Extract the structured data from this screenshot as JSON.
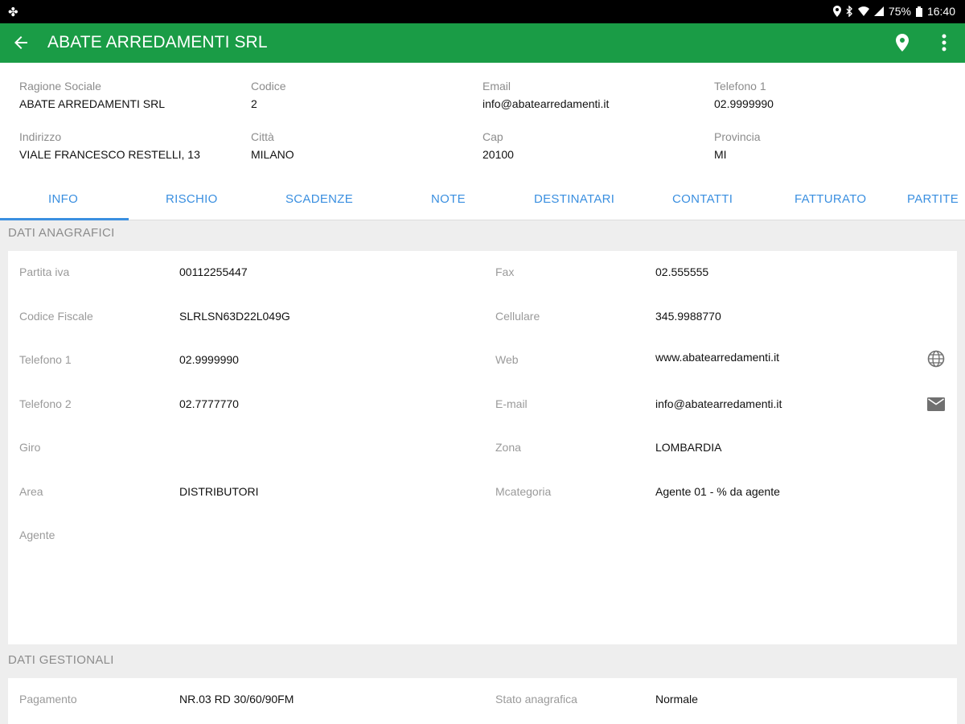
{
  "status_bar": {
    "left_icon": "app-notification-icon",
    "battery": "75%",
    "time": "16:40"
  },
  "app_bar": {
    "title": "ABATE ARREDAMENTI SRL",
    "icons": [
      "back-arrow-icon",
      "location-pin-icon",
      "more-vert-icon"
    ],
    "color": "#1a9c46"
  },
  "header": {
    "ragione_sociale": {
      "label": "Ragione Sociale",
      "value": "ABATE ARREDAMENTI SRL"
    },
    "codice": {
      "label": "Codice",
      "value": "2"
    },
    "email": {
      "label": "Email",
      "value": "info@abatearredamenti.it"
    },
    "telefono1": {
      "label": "Telefono 1",
      "value": "02.9999990"
    },
    "indirizzo": {
      "label": "Indirizzo",
      "value": "VIALE FRANCESCO RESTELLI, 13"
    },
    "citta": {
      "label": "Città",
      "value": "MILANO"
    },
    "cap": {
      "label": "Cap",
      "value": "20100"
    },
    "provincia": {
      "label": "Provincia",
      "value": "MI"
    }
  },
  "tabs": {
    "items": [
      "INFO",
      "RISCHIO",
      "SCADENZE",
      "NOTE",
      "DESTINATARI",
      "CONTATTI",
      "FATTURATO",
      "PARTITE"
    ],
    "selected": "INFO",
    "accent": "#3a8fe0"
  },
  "dati_anagrafici": {
    "title": "DATI ANAGRAFICI",
    "left": [
      {
        "label": "Partita iva",
        "value": "00112255447"
      },
      {
        "label": "Codice Fiscale",
        "value": "SLRLSN63D22L049G"
      },
      {
        "label": "Telefono 1",
        "value": "02.9999990"
      },
      {
        "label": "Telefono 2",
        "value": "02.7777770"
      },
      {
        "label": "Giro",
        "value": ""
      },
      {
        "label": "Area",
        "value": "DISTRIBUTORI"
      },
      {
        "label": "Agente",
        "value": ""
      }
    ],
    "right": [
      {
        "label": "Fax",
        "value": "02.555555"
      },
      {
        "label": "Cellulare",
        "value": "345.9988770"
      },
      {
        "label": "Web",
        "value": "www.abatearredamenti.it",
        "icon": "globe-icon"
      },
      {
        "label": "E-mail",
        "value": "info@abatearredamenti.it",
        "icon": "mail-icon"
      },
      {
        "label": "Zona",
        "value": "LOMBARDIA"
      },
      {
        "label": "Mcategoria",
        "value": "Agente 01 - % da agente"
      }
    ]
  },
  "dati_gestionali": {
    "title": "DATI GESTIONALI",
    "left": [
      {
        "label": "Pagamento",
        "value": "NR.03 RD 30/60/90FM"
      }
    ],
    "right": [
      {
        "label": "Stato anagrafica",
        "value": "Normale"
      }
    ]
  }
}
